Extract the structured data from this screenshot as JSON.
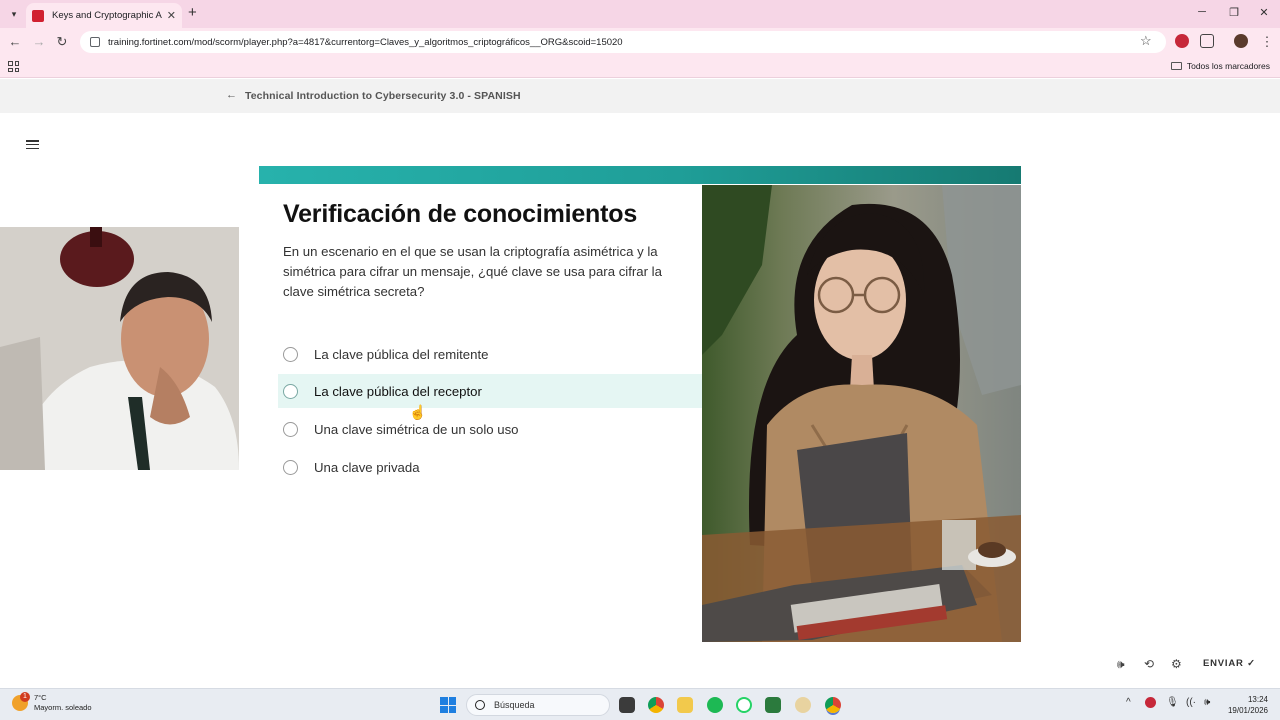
{
  "browser": {
    "tab_title": "Keys and Cryptographic Algorit",
    "tab_close": "✕",
    "new_tab": "+",
    "url": "training.fortinet.com/mod/scorm/player.php?a=4817&currentorg=Claves_y_algoritmos_criptográficos__ORG&scoid=15020",
    "bookmarks_all": "Todos los marcadores",
    "controls": {
      "back": "←",
      "forward": "→",
      "reload": "↻",
      "star": "☆",
      "menu": "⋮",
      "minimize": "─",
      "restore": "❐",
      "close": "✕"
    }
  },
  "course": {
    "back_arrow": "←",
    "title": "Technical Introduction to Cybersecurity 3.0 - SPANISH"
  },
  "quiz": {
    "title": "Verificación de conocimientos",
    "question": "En un escenario en el que se usan la criptografía asimétrica y la simétrica para cifrar un mensaje, ¿qué clave se usa para cifrar la clave simétrica secreta?",
    "options": [
      {
        "label": "La clave pública del remitente"
      },
      {
        "label": "La clave pública del receptor",
        "hovered": true
      },
      {
        "label": "Una clave simétrica de un solo uso"
      },
      {
        "label": "Una clave privada"
      }
    ],
    "accent_color": "#1f9e98"
  },
  "player": {
    "volume_icon": "🕪",
    "replay_icon": "⟲",
    "settings_icon": "⚙",
    "submit_label": "ENVIAR ✓"
  },
  "taskbar": {
    "weather_temp": "7°C",
    "weather_desc": "Mayorm. soleado",
    "weather_badge": "1",
    "search_label": "Búsqueda",
    "time": "13:24",
    "date": "19/01/2026",
    "tray": {
      "chevron": "^",
      "mic": "🎙",
      "wifi": "((·",
      "speaker": "🕪"
    }
  }
}
